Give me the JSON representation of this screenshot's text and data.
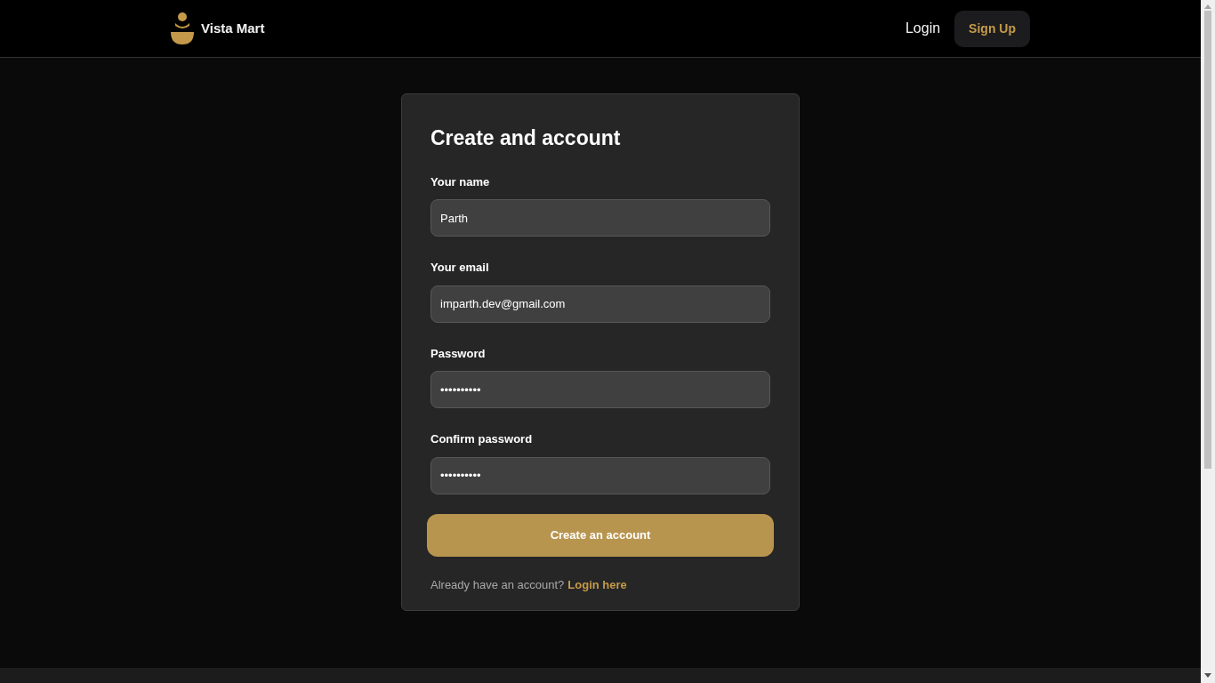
{
  "navbar": {
    "brand": "Vista Mart",
    "links": [
      {
        "label": "Login",
        "kind": "link"
      },
      {
        "label": "Sign Up",
        "kind": "button"
      }
    ]
  },
  "form": {
    "title": "Create and account",
    "fields": [
      {
        "label": "Your name",
        "value": "Parth"
      },
      {
        "label": "Your email",
        "value": "imparth.dev@gmail.com"
      },
      {
        "label": "Password",
        "value": "••••••••••"
      },
      {
        "label": "Confirm password",
        "value": "••••••••••"
      }
    ],
    "submit": "Create an account",
    "footer_text": "Already have an account?",
    "footer_link": "Login here"
  }
}
